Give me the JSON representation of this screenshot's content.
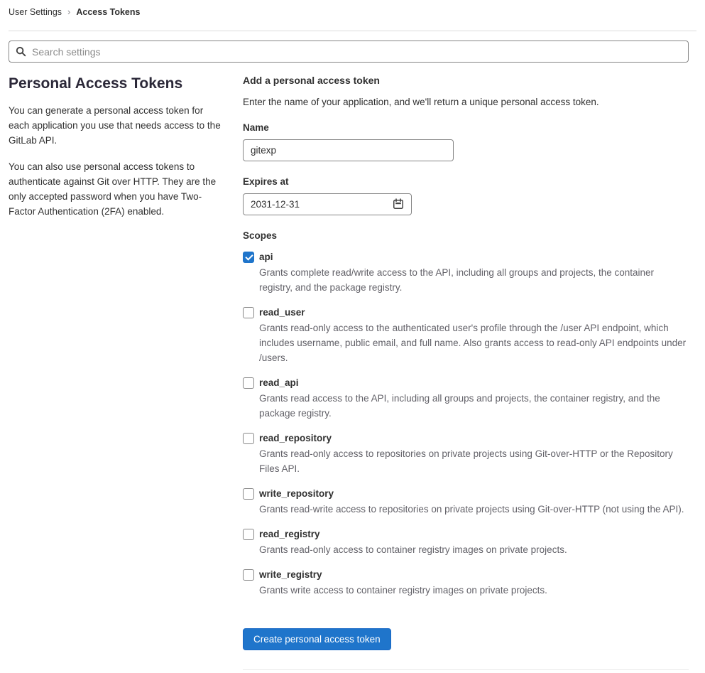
{
  "breadcrumb": {
    "parent": "User Settings",
    "separator": "›",
    "current": "Access Tokens"
  },
  "search": {
    "placeholder": "Search settings"
  },
  "sidebar": {
    "title": "Personal Access Tokens",
    "paragraphs": {
      "p1": "You can generate a personal access token for each application you use that needs access to the GitLab API.",
      "p2": "You can also use personal access tokens to authenticate against Git over HTTP. They are the only accepted password when you have Two-Factor Authentication (2FA) enabled."
    }
  },
  "form": {
    "title": "Add a personal access token",
    "description": "Enter the name of your application, and we'll return a unique personal access token.",
    "name_label": "Name",
    "name_value": "gitexp",
    "expires_label": "Expires at",
    "expires_value": "2031-12-31",
    "scopes_label": "Scopes",
    "scopes": [
      {
        "name": "api",
        "checked": true,
        "description": "Grants complete read/write access to the API, including all groups and projects, the container registry, and the package registry."
      },
      {
        "name": "read_user",
        "checked": false,
        "description": "Grants read-only access to the authenticated user's profile through the /user API endpoint, which includes username, public email, and full name. Also grants access to read-only API endpoints under /users."
      },
      {
        "name": "read_api",
        "checked": false,
        "description": "Grants read access to the API, including all groups and projects, the container registry, and the package registry."
      },
      {
        "name": "read_repository",
        "checked": false,
        "description": "Grants read-only access to repositories on private projects using Git-over-HTTP or the Repository Files API."
      },
      {
        "name": "write_repository",
        "checked": false,
        "description": "Grants read-write access to repositories on private projects using Git-over-HTTP (not using the API)."
      },
      {
        "name": "read_registry",
        "checked": false,
        "description": "Grants read-only access to container registry images on private projects."
      },
      {
        "name": "write_registry",
        "checked": false,
        "description": "Grants write access to container registry images on private projects."
      }
    ],
    "submit_label": "Create personal access token"
  },
  "icons": {
    "search": "magnifying-glass",
    "calendar": "calendar"
  },
  "colors": {
    "accent": "#1f75cb",
    "border": "#868686",
    "secondary_text": "#626168",
    "divider": "#dbdbdb"
  }
}
